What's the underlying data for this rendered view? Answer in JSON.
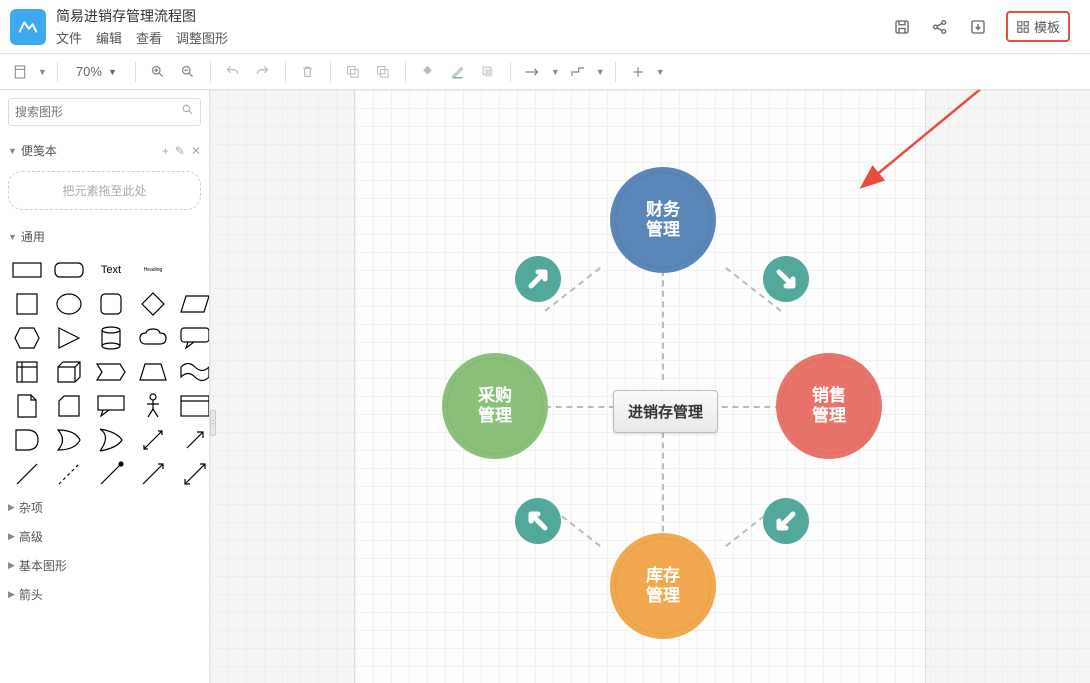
{
  "header": {
    "title": "简易进销存管理流程图",
    "menu": {
      "file": "文件",
      "edit": "编辑",
      "view": "查看",
      "adjust": "调整图形"
    },
    "template_label": "模板"
  },
  "toolbar": {
    "zoom": "70%"
  },
  "sidebar": {
    "search_placeholder": "搜索图形",
    "panels": {
      "notes": "便笺本",
      "dropzone": "把元素拖至此处",
      "general": "通用",
      "misc": "杂项",
      "advanced": "高级",
      "basic": "基本图形",
      "arrows": "箭头"
    },
    "text_shape_label": "Text",
    "heading_shape_label": "Heading"
  },
  "diagram": {
    "center": "进销存管理",
    "nodes": {
      "finance": "财务\n管理",
      "purchase": "采购\n管理",
      "sales": "销售\n管理",
      "inventory": "库存\n管理"
    }
  }
}
